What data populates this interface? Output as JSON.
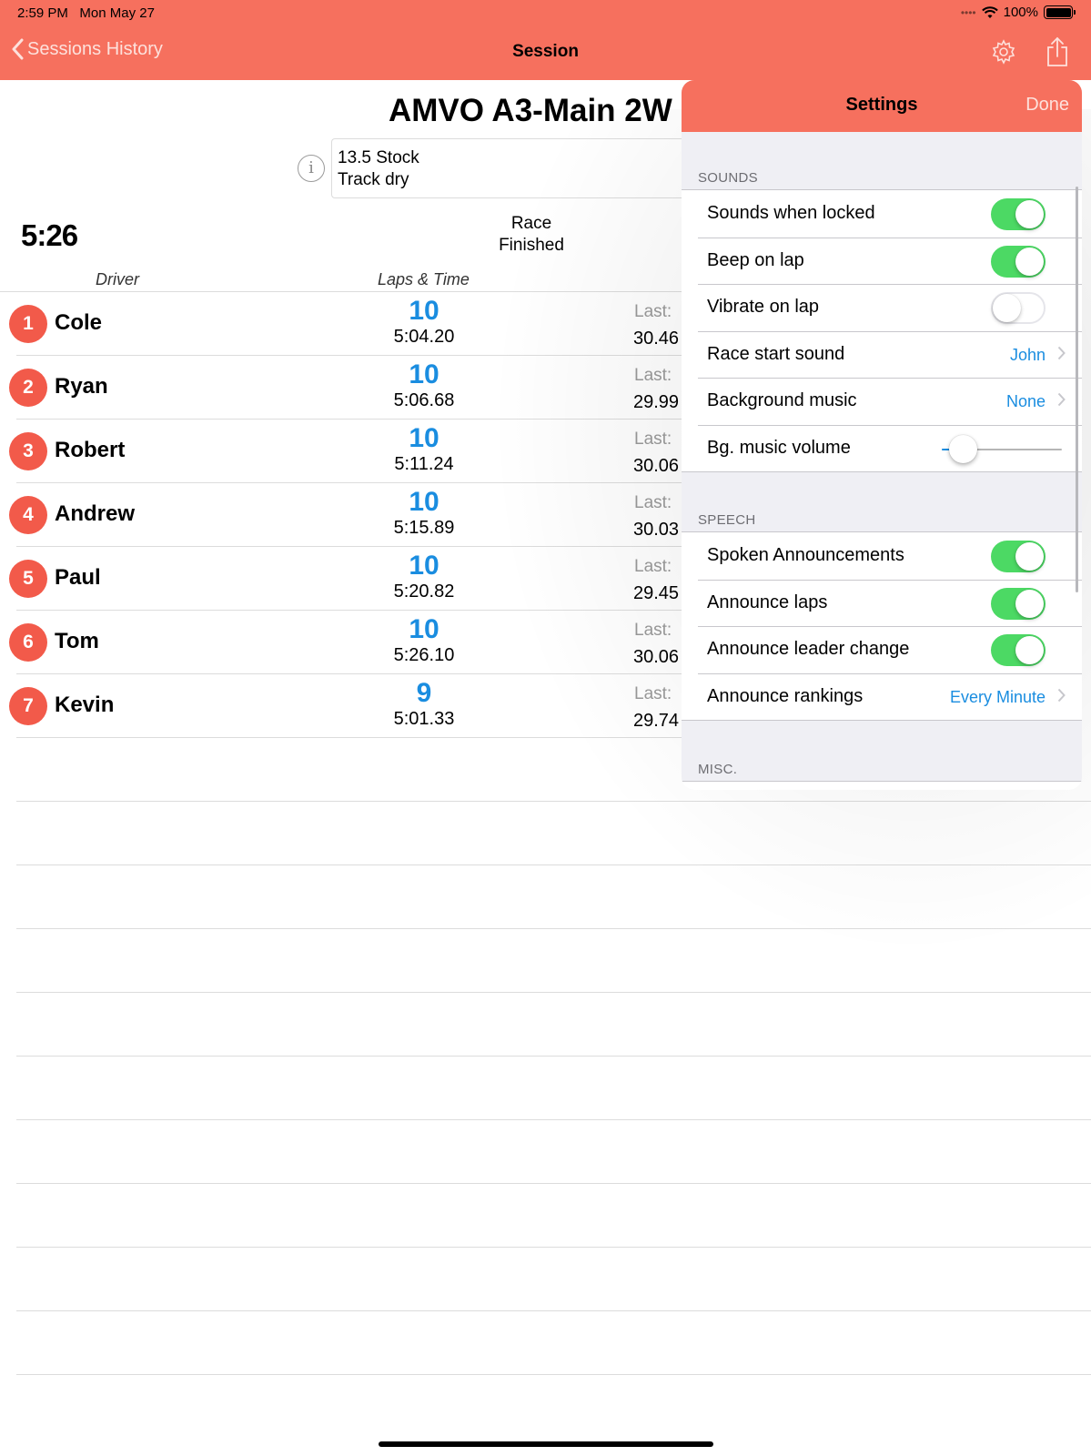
{
  "status_bar": {
    "time": "2:59 PM",
    "date": "Mon May 27",
    "battery": "100%"
  },
  "nav": {
    "back_label": "Sessions History",
    "title": "Session",
    "gear_icon": "gear-icon",
    "share_icon": "share-icon"
  },
  "session": {
    "title": "AMVO A3-Main 2W",
    "notes_line1": "13.5 Stock",
    "notes_line2": "Track dry",
    "clock": "5:26",
    "status_line1": "Race",
    "status_line2": "Finished"
  },
  "table": {
    "col_driver": "Driver",
    "col_laps": "Laps & Time",
    "last_label": "Last:",
    "rows": [
      {
        "pos": "1",
        "name": "Cole",
        "laps": "10",
        "time": "5:04.20",
        "last": "30.46"
      },
      {
        "pos": "2",
        "name": "Ryan",
        "laps": "10",
        "time": "5:06.68",
        "last": "29.99"
      },
      {
        "pos": "3",
        "name": "Robert",
        "laps": "10",
        "time": "5:11.24",
        "last": "30.06"
      },
      {
        "pos": "4",
        "name": "Andrew",
        "laps": "10",
        "time": "5:15.89",
        "last": "30.03"
      },
      {
        "pos": "5",
        "name": "Paul",
        "laps": "10",
        "time": "5:20.82",
        "last": "29.45"
      },
      {
        "pos": "6",
        "name": "Tom",
        "laps": "10",
        "time": "5:26.10",
        "last": "30.06"
      },
      {
        "pos": "7",
        "name": "Kevin",
        "laps": "9",
        "time": "5:01.33",
        "last": "29.74"
      }
    ]
  },
  "settings": {
    "title": "Settings",
    "done_label": "Done",
    "sounds": {
      "header": "SOUNDS",
      "sounds_when_locked": {
        "label": "Sounds when locked",
        "on": true
      },
      "beep_on_lap": {
        "label": "Beep on lap",
        "on": true
      },
      "vibrate_on_lap": {
        "label": "Vibrate on lap",
        "on": false
      },
      "race_start_sound": {
        "label": "Race start sound",
        "value": "John"
      },
      "background_music": {
        "label": "Background music",
        "value": "None"
      },
      "bg_music_volume": {
        "label": "Bg. music volume",
        "level": 0.18
      }
    },
    "speech": {
      "header": "SPEECH",
      "spoken_announcements": {
        "label": "Spoken Announcements",
        "on": true
      },
      "announce_laps": {
        "label": "Announce laps",
        "on": true
      },
      "announce_leader_change": {
        "label": "Announce leader change",
        "on": true
      },
      "announce_rankings": {
        "label": "Announce rankings",
        "value": "Every Minute"
      }
    },
    "misc": {
      "header": "MISC."
    }
  },
  "colors": {
    "accent": "#f6705e",
    "badge": "#f25a4a",
    "laps_blue": "#1a8de0",
    "toggle_on": "#4cd964"
  }
}
